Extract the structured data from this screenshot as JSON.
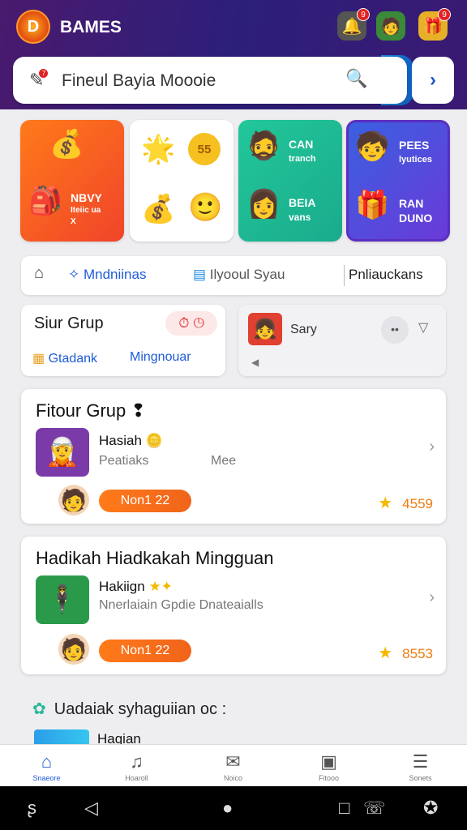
{
  "header": {
    "title": "BAMES",
    "logo_glyph": "D",
    "badges": [
      "9",
      "9"
    ]
  },
  "search": {
    "placeholder": "Fineul Bayia Moooie",
    "badge": "7",
    "go_icon": "chevron-right-icon"
  },
  "tiles": [
    {
      "lines": [
        "NBVY",
        "Iteiic ua",
        "X"
      ]
    },
    {
      "coin": "55"
    },
    {
      "lines": [
        "CAN",
        "tranch",
        "BEIA",
        "vans"
      ]
    },
    {
      "lines": [
        "PEES",
        "lyutices",
        "RAN",
        "DUNO"
      ]
    }
  ],
  "filters": {
    "a": "Mndniinas",
    "b": "Ilyooul Syau",
    "c": "Pnliauckans"
  },
  "group_box": {
    "title": "Siur Grup",
    "link_a": "Gtadank",
    "link_b": "Mingnouar"
  },
  "sary_box": {
    "label": "Sary"
  },
  "cards": [
    {
      "title": "Fitour Grup",
      "item_name": "Hasiah",
      "item_sub": "Peatiaks",
      "item_sub2": "Mee",
      "pill": "Non1 22",
      "score": "4559"
    },
    {
      "title": "Hadikah Hiadkakah Mingguan",
      "item_name": "Hakiign",
      "item_sub": "Nnerlaiain Gpdie Dnateaialls",
      "pill": "Non1 22",
      "score": "8553"
    }
  ],
  "section": {
    "title": "Uadaiak syhaguiian",
    "suffix": "oc :"
  },
  "peek": {
    "label": "Hagian"
  },
  "tabs": [
    "Snaeore",
    "Hoaroll",
    "Noico",
    "Fitooo",
    "Sonets"
  ],
  "colors": {
    "header": "#2c1f7a",
    "accent": "#1f5cd6",
    "orange": "#f0641a",
    "green": "#22c79a"
  }
}
